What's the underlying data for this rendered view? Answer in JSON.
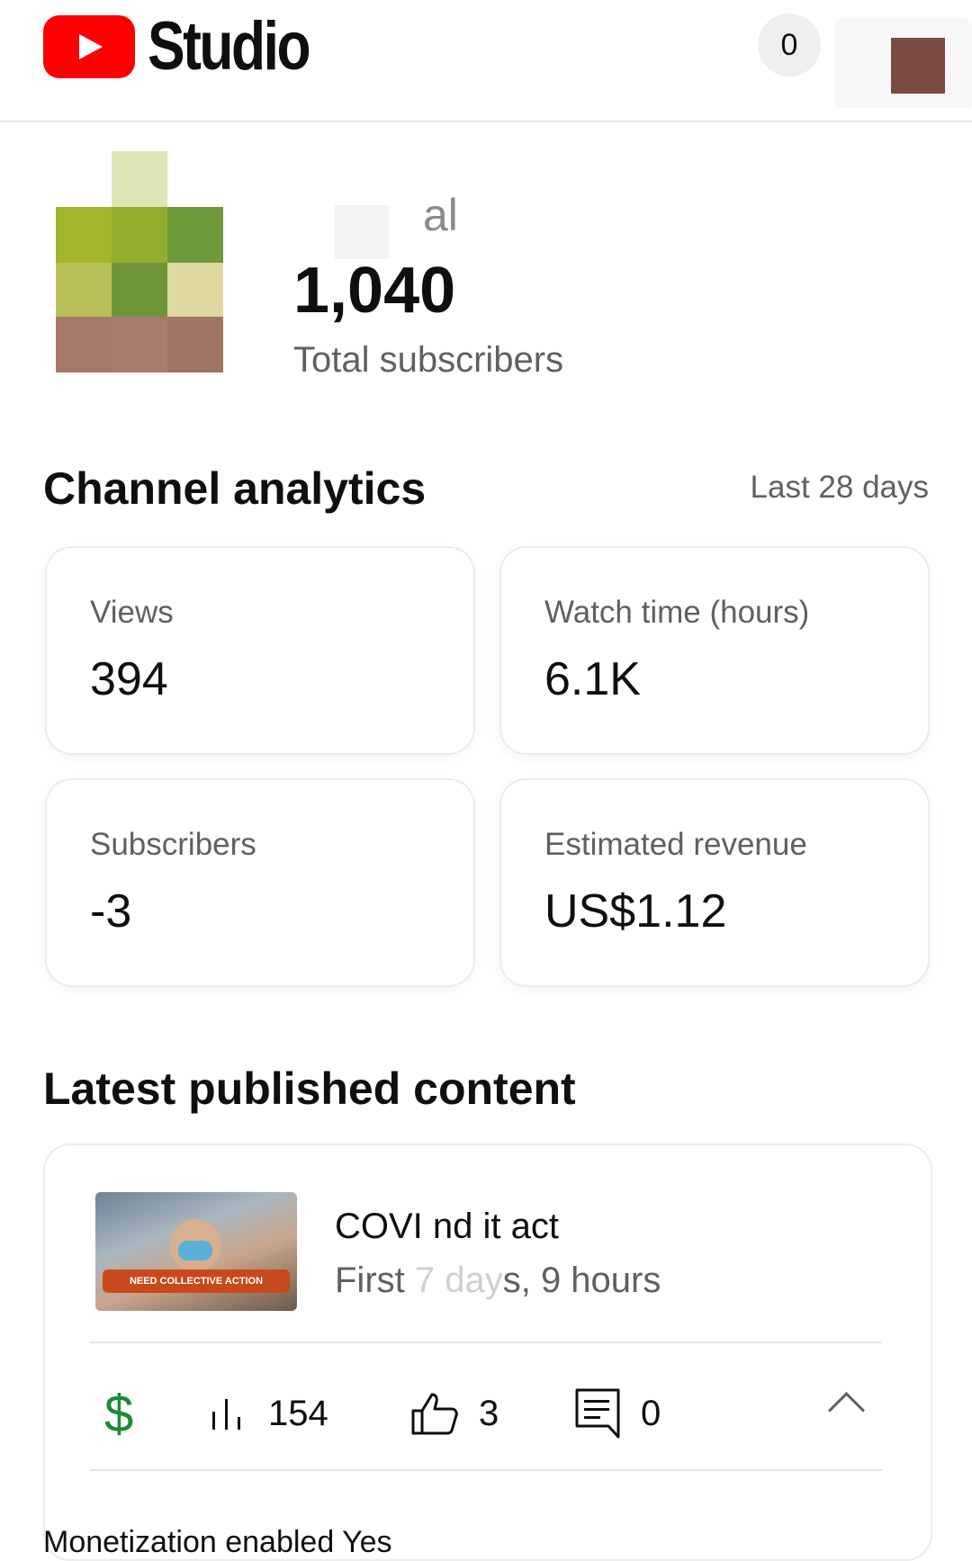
{
  "header": {
    "app_name": "Studio",
    "notification_count": "0"
  },
  "channel": {
    "name_fragment": "al",
    "subscriber_count": "1,040",
    "subscriber_label": "Total subscribers"
  },
  "analytics": {
    "title": "Channel analytics",
    "range": "Last 28 days",
    "cards": [
      {
        "label": "Views",
        "value": "394"
      },
      {
        "label": "Watch time (hours)",
        "value": "6.1K"
      },
      {
        "label": "Subscribers",
        "value": "-3"
      },
      {
        "label": "Estimated revenue",
        "value": "US$1.12"
      }
    ]
  },
  "latest": {
    "title": "Latest published content",
    "video": {
      "thumbnail_banner": "NEED COLLECTIVE ACTION",
      "title_fragment": "COVI      nd it        act",
      "meta_fragment": "First 7 days, 9 hours",
      "views": "154",
      "likes": "3",
      "comments": "0"
    },
    "next_row_fragment": "Monetization enabled   Yes"
  },
  "colors": {
    "brand_red": "#ff0000",
    "revenue_green": "#1d8a3a"
  },
  "icons": {
    "logo": "youtube-play-icon",
    "revenue": "dollar-icon",
    "views": "bar-chart-icon",
    "likes": "thumbs-up-icon",
    "comments": "comment-icon",
    "expand": "chevron-up-icon"
  }
}
